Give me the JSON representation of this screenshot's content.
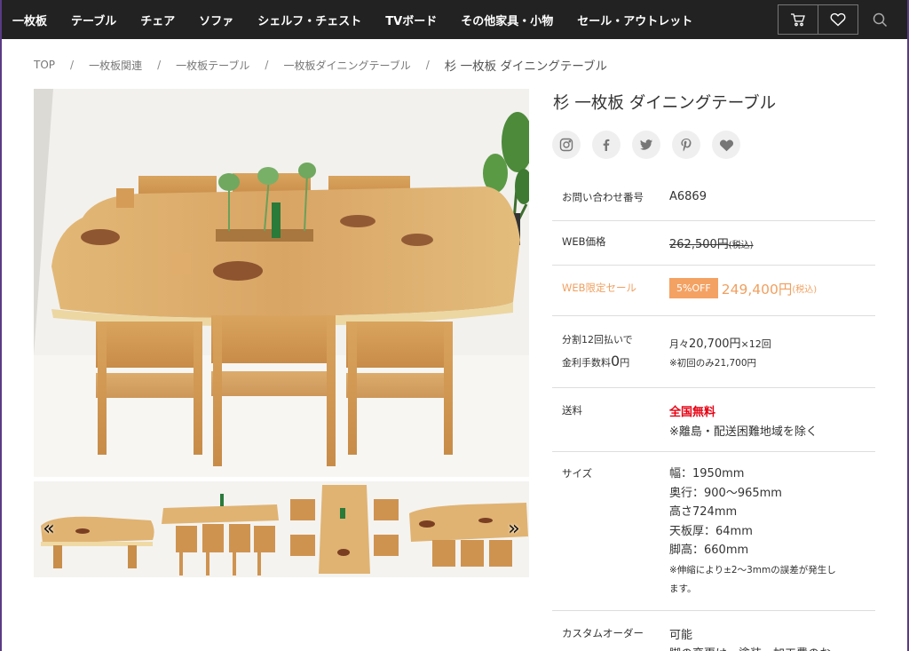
{
  "nav": {
    "items": [
      "一枚板",
      "テーブル",
      "チェア",
      "ソファ",
      "シェルフ・チェスト",
      "TVボード",
      "その他家具・小物",
      "セール・アウトレット"
    ],
    "cart_icon": "cart-icon",
    "heart_icon": "heart-icon",
    "search_icon": "search-icon"
  },
  "breadcrumb": {
    "items": [
      "TOP",
      "一枚板関連",
      "一枚板テーブル",
      "一枚板ダイニングテーブル"
    ],
    "separator": "/",
    "current": "杉 一枚板 ダイニングテーブル"
  },
  "gallery": {
    "prev_label": "«",
    "next_label": "»"
  },
  "product": {
    "title": "杉 一枚板 ダイニングテーブル",
    "social_icons": [
      "instagram-icon",
      "facebook-icon",
      "twitter-icon",
      "pinterest-icon",
      "heart-icon"
    ]
  },
  "specs": {
    "inquiry_label": "お問い合わせ番号",
    "inquiry_value": "A6869",
    "web_price_label": "WEB価格",
    "web_price_value": "262,500円",
    "web_price_tax": "(税込)",
    "sale_label": "WEB限定セール",
    "sale_badge": "5%OFF",
    "sale_price": "249,400円",
    "sale_tax": "(税込)",
    "installment_label_1": "分割12回払いで",
    "installment_label_2a": "金利手数料",
    "installment_label_2b": "0",
    "installment_label_2c": "円",
    "installment_value_1a": "月々",
    "installment_value_1b": "20,700円",
    "installment_value_1c": "×12回",
    "installment_value_2": "※初回のみ21,700円",
    "shipping_label": "送料",
    "shipping_value": "全国無料",
    "shipping_note": "※離島・配送困難地域を除く",
    "size_label": "サイズ",
    "size_lines": [
      "幅：1950mm",
      "奥行：900〜965mm",
      "高さ724mm",
      "天板厚：64mm",
      "脚高：660mm"
    ],
    "size_note_1": "※伸縮により±2〜3mmの誤差が発生し",
    "size_note_2": "ます。",
    "custom_label": "カスタムオーダー",
    "custom_value": "可能",
    "custom_note": "脚の変更は、塗装、加工費のお"
  },
  "colors": {
    "nav_bg": "#222222",
    "accent_orange": "#f0a060",
    "badge_orange": "#f4a263",
    "free_red": "#e60012"
  }
}
